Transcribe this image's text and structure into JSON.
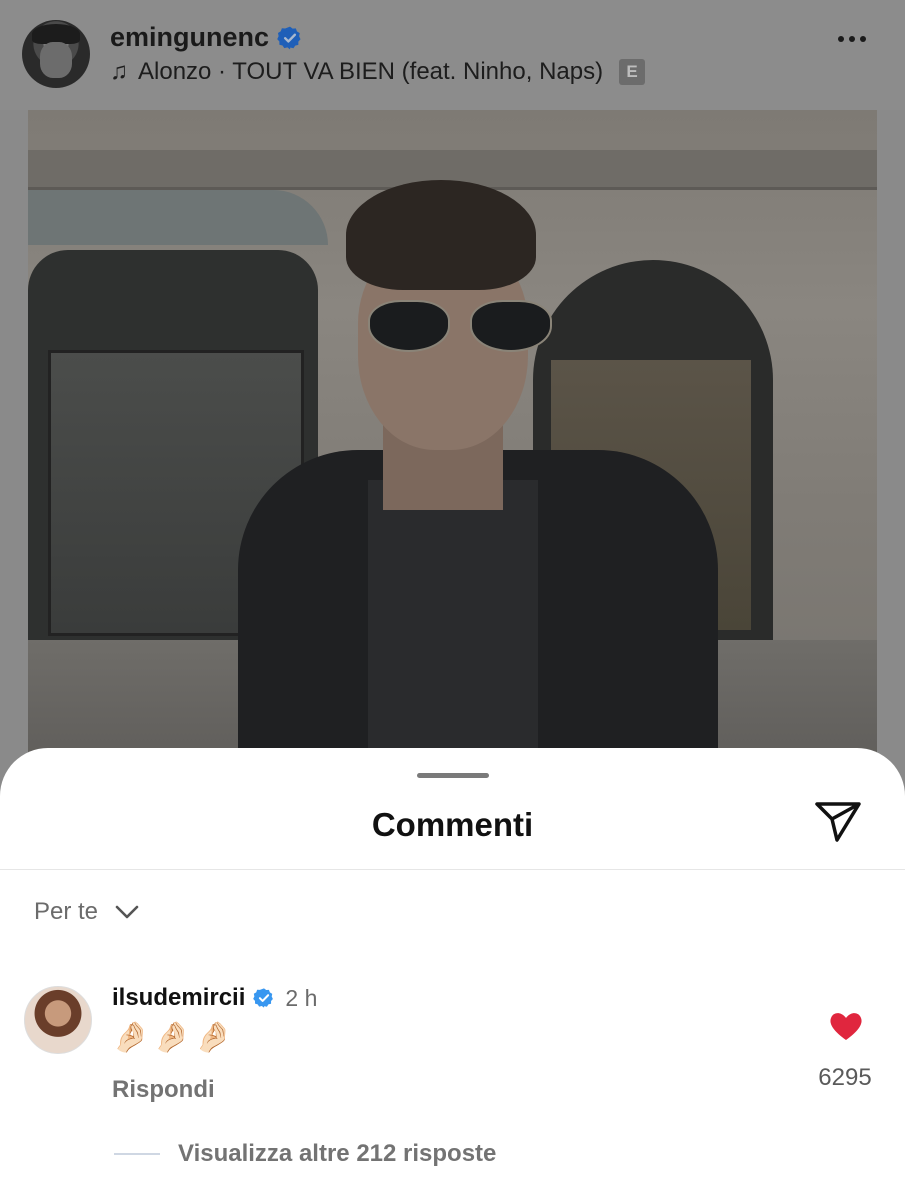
{
  "post": {
    "username": "emingunenc",
    "music": "Alonzo · TOUT VA BIEN (feat. Ninho, Naps)",
    "explicit_badge": "E"
  },
  "sheet": {
    "title": "Commenti",
    "sort_label": "Per te"
  },
  "comment": {
    "username": "ilsudemircii",
    "time": "2 h",
    "text": "🤌🏻🤌🏻🤌🏻",
    "reply_label": "Rispondi",
    "likes": "6295",
    "view_replies": "Visualizza altre 212 risposte"
  },
  "colors": {
    "verified": "#3897f0",
    "heart": "#e0263e"
  }
}
